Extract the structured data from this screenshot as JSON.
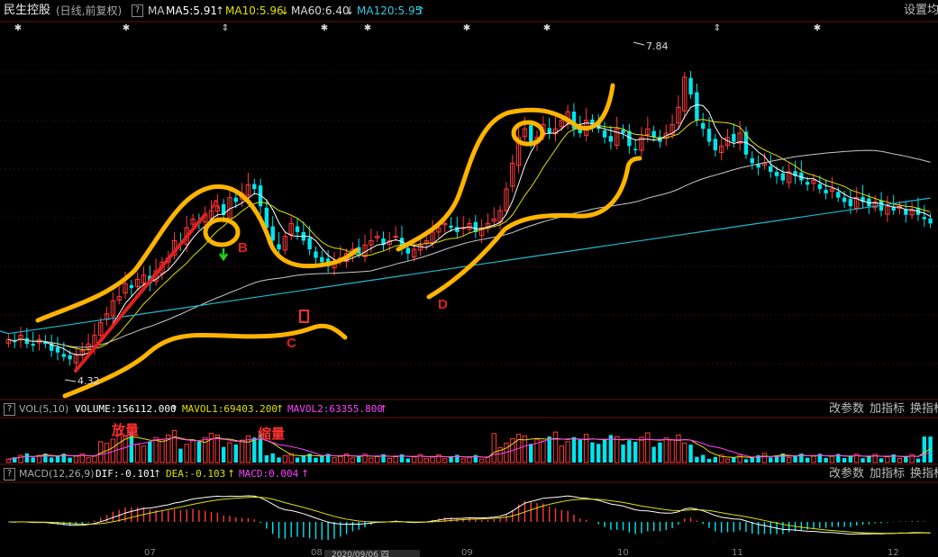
{
  "header": {
    "stock_name": "民生控股",
    "period": "(日线,前复权)",
    "help": "?",
    "ma_label": "MA",
    "ma5": "MA5:5.91",
    "ma10": "MA10:5.96",
    "ma60": "MA60:6.40",
    "ma120": "MA120:5.95",
    "arrow_up": "↑",
    "arrow_down": "↓",
    "settings": "设置均"
  },
  "colors": {
    "up": "#ff3b3b",
    "down": "#00e5ee",
    "ma5": "#ffffff",
    "ma10": "#e0e000",
    "ma60": "#c8c8c8",
    "ma120": "#20b8d0",
    "mavol2": "#ff40ff",
    "annotation": "#ffb400",
    "red_marker": "#e02020"
  },
  "price_labels": {
    "high": "7.84",
    "low": "4.32"
  },
  "annotations": {
    "A": "A",
    "B": "B",
    "C": "C",
    "D": "D",
    "vol_up": "放量",
    "vol_down": "缩量"
  },
  "volume_header": {
    "help": "?",
    "name": "VOL(5,10)",
    "volume": "VOLUME:156112.000",
    "mavol1": "MAVOL1:69403.200",
    "mavol2": "MAVOL2:63355.800",
    "arrow_up": "↑"
  },
  "macd_header": {
    "help": "?",
    "name": "MACD(12,26,9)",
    "dif": "DIF:-0.101",
    "dea": "DEA:-0.103",
    "macd": "MACD:0.004",
    "arrow_up": "↑"
  },
  "panel_buttons": {
    "params": "改参数",
    "add": "加指标",
    "switch": "换指标"
  },
  "date_axis": [
    "07",
    "08",
    "09",
    "10",
    "11",
    "12"
  ],
  "date_tooltip": "2020/09/06 四",
  "chart_data": {
    "type": "candlestick",
    "price_range": [
      4.0,
      8.1
    ],
    "high_label": 7.84,
    "low_label": 4.32,
    "closes": [
      4.55,
      4.52,
      4.6,
      4.5,
      4.48,
      4.55,
      4.5,
      4.42,
      4.4,
      4.35,
      4.32,
      4.38,
      4.42,
      4.5,
      4.6,
      4.75,
      4.85,
      5.0,
      5.05,
      5.2,
      5.15,
      5.25,
      5.3,
      5.2,
      5.35,
      5.45,
      5.5,
      5.7,
      5.65,
      5.85,
      5.95,
      5.9,
      6.0,
      6.05,
      6.1,
      6.0,
      6.2,
      6.15,
      6.25,
      6.35,
      6.3,
      6.1,
      5.85,
      5.7,
      5.6,
      5.75,
      5.9,
      5.8,
      5.7,
      5.6,
      5.5,
      5.45,
      5.4,
      5.45,
      5.5,
      5.55,
      5.6,
      5.55,
      5.65,
      5.7,
      5.75,
      5.65,
      5.7,
      5.75,
      5.6,
      5.55,
      5.6,
      5.65,
      5.7,
      5.8,
      5.85,
      5.9,
      5.85,
      5.8,
      5.85,
      5.9,
      5.8,
      5.85,
      5.9,
      5.95,
      6.05,
      6.3,
      6.6,
      6.9,
      7.0,
      6.85,
      6.9,
      7.05,
      6.95,
      7.0,
      7.1,
      7.2,
      7.0,
      6.95,
      7.1,
      7.05,
      7.0,
      6.9,
      6.85,
      7.0,
      6.95,
      6.8,
      6.75,
      6.9,
      7.0,
      6.9,
      6.85,
      6.95,
      7.05,
      7.25,
      7.6,
      7.4,
      7.1,
      7.0,
      6.85,
      6.75,
      6.8,
      6.9,
      6.85,
      6.95,
      6.7,
      6.6,
      6.55,
      6.6,
      6.5,
      6.45,
      6.4,
      6.5,
      6.45,
      6.4,
      6.35,
      6.4,
      6.3,
      6.25,
      6.3,
      6.2,
      6.15,
      6.1,
      6.2,
      6.15,
      6.1,
      6.15,
      6.05,
      6.1,
      6.05,
      6.1,
      6.0,
      6.05,
      6.0,
      5.95,
      5.9
    ],
    "volume_range": [
      0,
      260000
    ],
    "macd_range": [
      -0.35,
      0.35
    ]
  }
}
